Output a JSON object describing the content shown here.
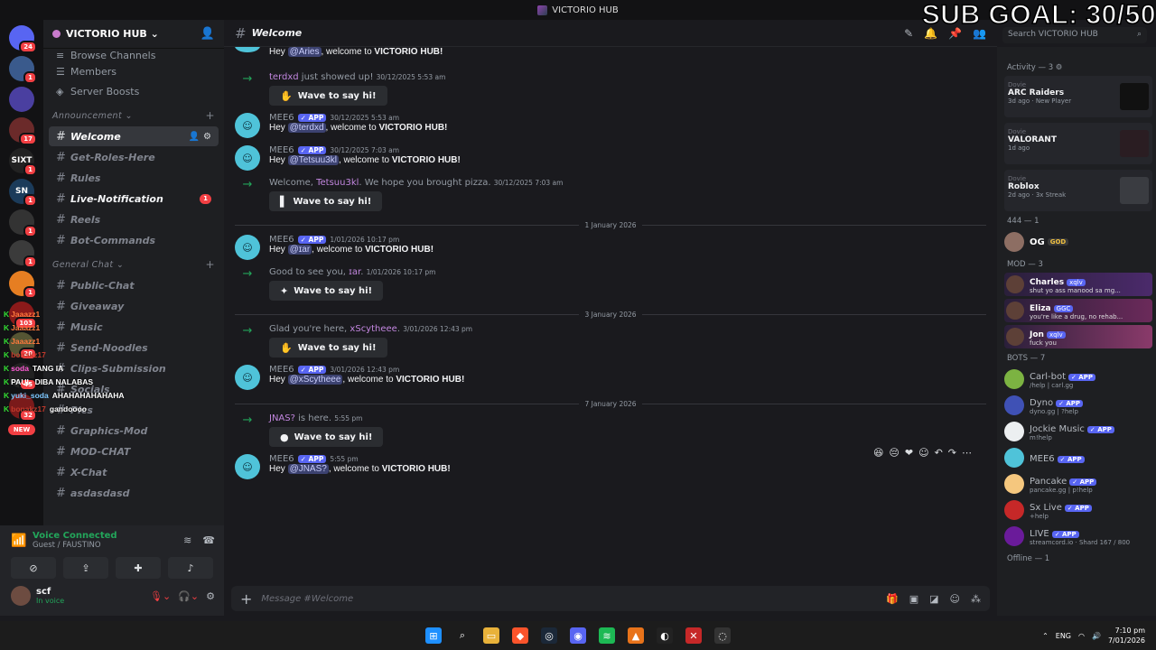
{
  "window": {
    "title": "VICTORIO HUB"
  },
  "overlay": {
    "sub_goal": "SUB GOAL: 30/50"
  },
  "guilds": [
    {
      "label": "",
      "badge": "24"
    },
    {
      "label": "",
      "badge": "1"
    },
    {
      "label": "",
      "badge": ""
    },
    {
      "label": "",
      "badge": "17"
    },
    {
      "label": "SIXT",
      "badge": "1"
    },
    {
      "label": "SN",
      "badge": "1"
    },
    {
      "label": "",
      "badge": "1"
    },
    {
      "label": "",
      "badge": "1"
    },
    {
      "label": "",
      "badge": "1"
    },
    {
      "label": "",
      "badge": "103"
    },
    {
      "label": "",
      "badge": "28"
    },
    {
      "label": "",
      "badge": "45"
    },
    {
      "label": "",
      "badge": "32"
    }
  ],
  "guild_new": "NEW",
  "server": {
    "name": "VICTORIO HUB",
    "chevron": "⌄"
  },
  "nav": [
    {
      "label": "Browse Channels",
      "icon": "≡"
    },
    {
      "label": "Members",
      "icon": "☰"
    },
    {
      "label": "Server Boosts",
      "icon": "◈"
    }
  ],
  "categories": {
    "announcement": "Announcement",
    "general": "General Chat"
  },
  "announce_channels": [
    "Welcome",
    "Get-Roles-Here",
    "Rules",
    "Live-Notification",
    "Reels",
    "Bot-Commands"
  ],
  "general_channels": [
    "Public-Chat",
    "Giveaway",
    "Music",
    "Send-Noodles",
    "Clips-Submission",
    "Socials",
    "Pics",
    "Graphics-Mod",
    "MOD-CHAT",
    "X-Chat",
    "asdasdasd"
  ],
  "live_notification_badge": "1",
  "stream_chat": [
    {
      "name": "Jaaazz1",
      "color": "#ff7a3d",
      "msg": ""
    },
    {
      "name": "Jaaazz1",
      "color": "#ff7a3d",
      "msg": ""
    },
    {
      "name": "Jaaazz1",
      "color": "#ff7a3d",
      "msg": ""
    },
    {
      "name": "bonakz17",
      "color": "#c0392b",
      "msg": ""
    },
    {
      "name": "soda",
      "color": "#ff5bd6",
      "msg": "TANG IA"
    },
    {
      "name": "PAUL",
      "color": "#ffffff",
      "msg": "DIBA NALABAS"
    },
    {
      "name": "yuki_soda",
      "color": "#7ec8ff",
      "msg": "AHAHAHAHAHAHA"
    },
    {
      "name": "bonakz17",
      "color": "#c0392b",
      "msg": "gandoooo"
    }
  ],
  "voice": {
    "title": "Voice Connected",
    "sub": "Guest / FAUSTINO"
  },
  "user": {
    "name": "scf",
    "status": "In voice"
  },
  "channel": {
    "name": "Welcome",
    "composer_placeholder": "Message #Welcome"
  },
  "search": {
    "placeholder": "Search VICTORIO HUB"
  },
  "messages": [
    {
      "kind": "mee6_partial",
      "pre": "Hey ",
      "mention": "@Aries",
      "post": ", welcome to ",
      "bold": "VICTORIO HUB!"
    },
    {
      "kind": "sys",
      "prefix": "",
      "who": "terdxd",
      "suffix": " just showed up!",
      "time": "30/12/2025 5:53 am",
      "wave": "Wave to say hi!",
      "sticker": "✋"
    },
    {
      "kind": "mee6",
      "name": "MEE6",
      "tag": "✓ APP",
      "time": "30/12/2025 5:53 am",
      "pre": "Hey ",
      "mention": "@terdxd",
      "post": ", welcome to ",
      "bold": "VICTORIO HUB!"
    },
    {
      "kind": "mee6",
      "name": "MEE6",
      "tag": "✓ APP",
      "time": "30/12/2025 7:03 am",
      "pre": "Hey ",
      "mention": "@Tetsuu3kl",
      "post": ", welcome to ",
      "bold": "VICTORIO HUB!"
    },
    {
      "kind": "sys",
      "prefix": "Welcome, ",
      "who": "Tetsuu3kl",
      "suffix": ". We hope you brought pizza.",
      "time": "30/12/2025 7:03 am",
      "wave": "Wave to say hi!",
      "sticker": "▌"
    },
    {
      "kind": "divider",
      "label": "1 January 2026"
    },
    {
      "kind": "mee6",
      "name": "MEE6",
      "tag": "✓ APP",
      "time": "1/01/2026 10:17 pm",
      "pre": "Hey ",
      "mention": "@ɪar",
      "post": ", welcome to ",
      "bold": "VICTORIO HUB!"
    },
    {
      "kind": "sys",
      "prefix": "Good to see you, ",
      "who": "ɪar",
      "suffix": ".",
      "time": "1/01/2026 10:17 pm",
      "wave": "Wave to say hi!",
      "sticker": "✦"
    },
    {
      "kind": "divider",
      "label": "3 January 2026"
    },
    {
      "kind": "sys",
      "prefix": "Glad you're here, ",
      "who": "xScytheee",
      "suffix": ".",
      "time": "3/01/2026 12:43 pm",
      "wave": "Wave to say hi!",
      "sticker": "✋"
    },
    {
      "kind": "mee6",
      "name": "MEE6",
      "tag": "✓ APP",
      "time": "3/01/2026 12:43 pm",
      "pre": "Hey ",
      "mention": "@xScytheee",
      "post": ", welcome to ",
      "bold": "VICTORIO HUB!"
    },
    {
      "kind": "divider",
      "label": "7 January 2026"
    },
    {
      "kind": "sys",
      "prefix": "",
      "who": "JNAS?",
      "suffix": " is here.",
      "time": "5:55 pm",
      "wave": "Wave to say hi!",
      "sticker": "●"
    },
    {
      "kind": "mee6",
      "name": "MEE6",
      "tag": "✓ APP",
      "time": "5:55 pm",
      "pre": "Hey ",
      "mention": "@JNAS?",
      "post": ", welcome to ",
      "bold": "VICTORIO HUB!"
    }
  ],
  "activity": {
    "header": "Activity — 3",
    "cards": [
      {
        "user": "Dovie",
        "title": "ARC Raiders",
        "sub": "3d ago · New Player",
        "color": "#111"
      },
      {
        "user": "Dovie",
        "title": "VALORANT",
        "sub": "1d ago",
        "color": "#2a1d22"
      },
      {
        "user": "Dovie",
        "title": "Roblox",
        "sub": "2d ago · 3x Streak",
        "color": "#3a3c41"
      }
    ]
  },
  "role_444": {
    "header": "444 — 1",
    "members": [
      {
        "name": "OG",
        "tag": "GOD"
      }
    ]
  },
  "role_mod": {
    "header": "MOD — 3",
    "members": [
      {
        "name": "Charles",
        "tag": "xqlv",
        "sub": "shut yo ass manood sa mg..."
      },
      {
        "name": "Eliza",
        "tag": "GGC",
        "sub": "you're like a drug, no rehab..."
      },
      {
        "name": "Jon",
        "tag": "xqlv",
        "sub": "fuck you"
      }
    ]
  },
  "role_bots": {
    "header": "BOTS — 7",
    "members": [
      {
        "name": "Carl-bot",
        "sub": "/help | carl.gg",
        "color": "#7cb342"
      },
      {
        "name": "Dyno",
        "sub": "dyno.gg | ?help",
        "color": "#3f51b5"
      },
      {
        "name": "Jockie Music",
        "sub": "m!help",
        "color": "#eceff1"
      },
      {
        "name": "MEE6",
        "sub": "",
        "color": "#4fc3d9"
      },
      {
        "name": "Pancake",
        "sub": "pancake.gg | p!help",
        "color": "#f5c77e"
      },
      {
        "name": "Sx Live",
        "sub": "+help",
        "color": "#c62828"
      },
      {
        "name": "LIVE",
        "sub": "streamcord.io · Shard 167 / 800",
        "color": "#6a1b9a"
      }
    ]
  },
  "bot_tag": "✓ APP",
  "offline_header": "Offline — 1",
  "tray": {
    "lang": "ENG",
    "time": "7:10 pm",
    "date": "7/01/2026"
  }
}
